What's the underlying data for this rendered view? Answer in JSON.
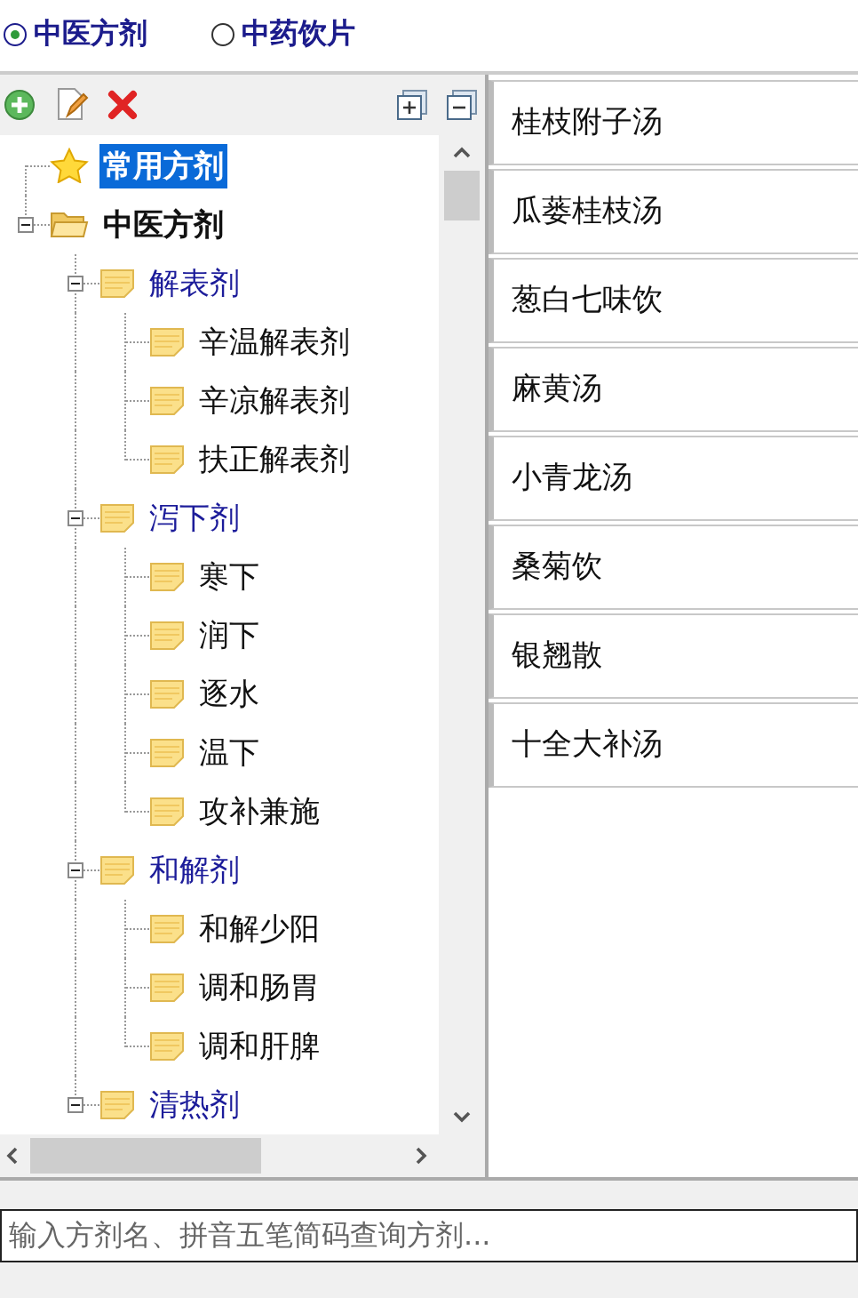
{
  "radios": [
    {
      "label": "中医方剂",
      "selected": true
    },
    {
      "label": "中药饮片",
      "selected": false
    }
  ],
  "tree": [
    {
      "label": "常用方剂",
      "kind": "star",
      "selected": true
    },
    {
      "label": "中医方剂",
      "kind": "folder",
      "selected": false,
      "expanded": true,
      "children": [
        {
          "label": "解表剂",
          "kind": "note",
          "selected": false,
          "expanded": true,
          "children": [
            {
              "label": "辛温解表剂",
              "kind": "note",
              "selected": false
            },
            {
              "label": "辛凉解表剂",
              "kind": "note",
              "selected": false
            },
            {
              "label": "扶正解表剂",
              "kind": "note",
              "selected": false
            }
          ]
        },
        {
          "label": "泻下剂",
          "kind": "note",
          "selected": false,
          "expanded": true,
          "children": [
            {
              "label": "寒下",
              "kind": "note",
              "selected": false
            },
            {
              "label": "润下",
              "kind": "note",
              "selected": false
            },
            {
              "label": "逐水",
              "kind": "note",
              "selected": false
            },
            {
              "label": "温下",
              "kind": "note",
              "selected": false
            },
            {
              "label": "攻补兼施",
              "kind": "note",
              "selected": false
            }
          ]
        },
        {
          "label": "和解剂",
          "kind": "note",
          "selected": false,
          "expanded": true,
          "children": [
            {
              "label": "和解少阳",
              "kind": "note",
              "selected": false
            },
            {
              "label": "调和肠胃",
              "kind": "note",
              "selected": false
            },
            {
              "label": "调和肝脾",
              "kind": "note",
              "selected": false
            }
          ]
        },
        {
          "label": "清热剂",
          "kind": "note",
          "selected": false,
          "expanded": true
        }
      ]
    }
  ],
  "formulas": [
    "桂枝附子汤",
    "瓜蒌桂枝汤",
    "葱白七味饮",
    "麻黄汤",
    "小青龙汤",
    "桑菊饮",
    "银翘散",
    "十全大补汤"
  ],
  "search": {
    "placeholder": "输入方剂名、拼音五笔简码查询方剂..."
  }
}
